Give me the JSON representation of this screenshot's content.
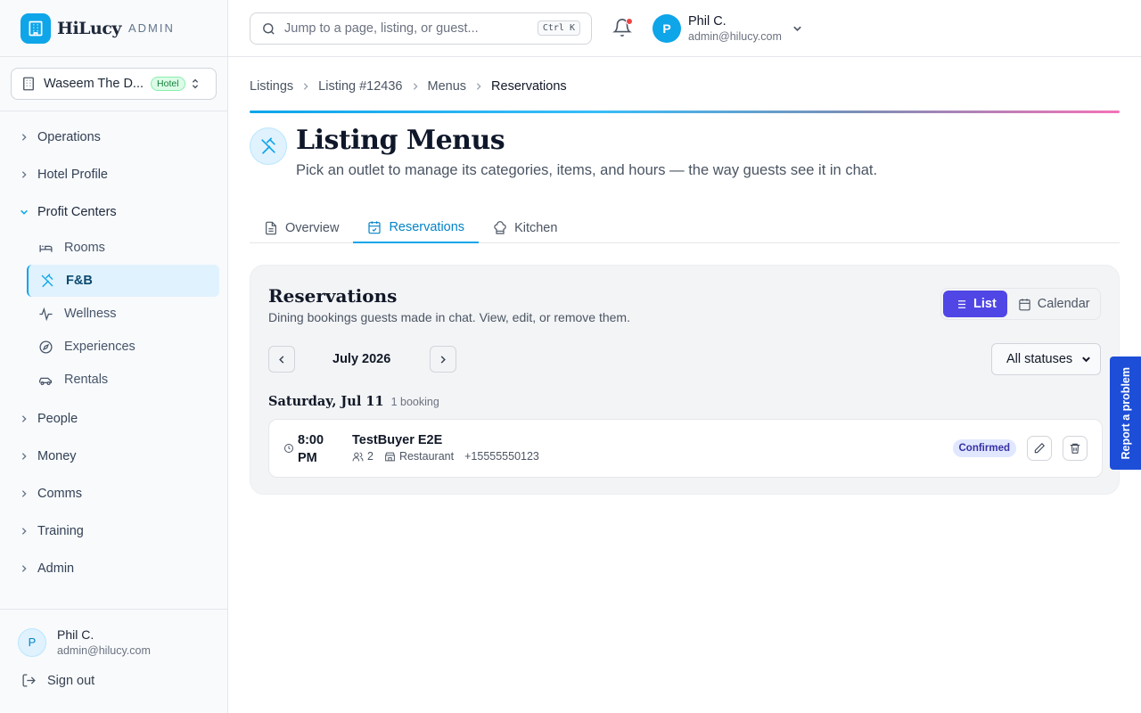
{
  "brand": {
    "name": "HiLucy",
    "tag": "ADMIN"
  },
  "property": {
    "name": "Waseem The D...",
    "badge": "Hotel"
  },
  "nav": {
    "operations": "Operations",
    "hotel_profile": "Hotel Profile",
    "profit_centers": "Profit Centers",
    "rooms": "Rooms",
    "fnb": "F&B",
    "wellness": "Wellness",
    "experiences": "Experiences",
    "rentals": "Rentals",
    "people": "People",
    "money": "Money",
    "comms": "Comms",
    "training": "Training",
    "admin": "Admin"
  },
  "sidebar_user": {
    "initial": "P",
    "name": "Phil C.",
    "email": "admin@hilucy.com",
    "signout": "Sign out"
  },
  "search": {
    "placeholder": "Jump to a page, listing, or guest...",
    "shortcut": "Ctrl K"
  },
  "top_user": {
    "initial": "P",
    "name": "Phil C.",
    "email": "admin@hilucy.com"
  },
  "breadcrumbs": [
    "Listings",
    "Listing #12436",
    "Menus",
    "Reservations"
  ],
  "page": {
    "title": "Listing Menus",
    "subtitle": "Pick an outlet to manage its categories, items, and hours — the way guests see it in chat."
  },
  "tabs": [
    "Overview",
    "Reservations",
    "Kitchen"
  ],
  "reservations": {
    "title": "Reservations",
    "subtitle": "Dining bookings guests made in chat. View, edit, or remove them.",
    "view_list": "List",
    "view_calendar": "Calendar",
    "month": "July 2026",
    "status_filter": "All statuses",
    "day": {
      "label": "Saturday, Jul 11",
      "count": "1 booking"
    },
    "booking": {
      "time": "8:00 PM",
      "guest": "TestBuyer E2E",
      "party": "2",
      "outlet": "Restaurant",
      "phone": "+15555550123",
      "status": "Confirmed"
    }
  },
  "report_button": "Report a problem",
  "colors": {
    "accent": "#0ea5e9",
    "primary_button": "#4f46e5",
    "alert": "#ef4444",
    "report": "#1d4ed8"
  }
}
